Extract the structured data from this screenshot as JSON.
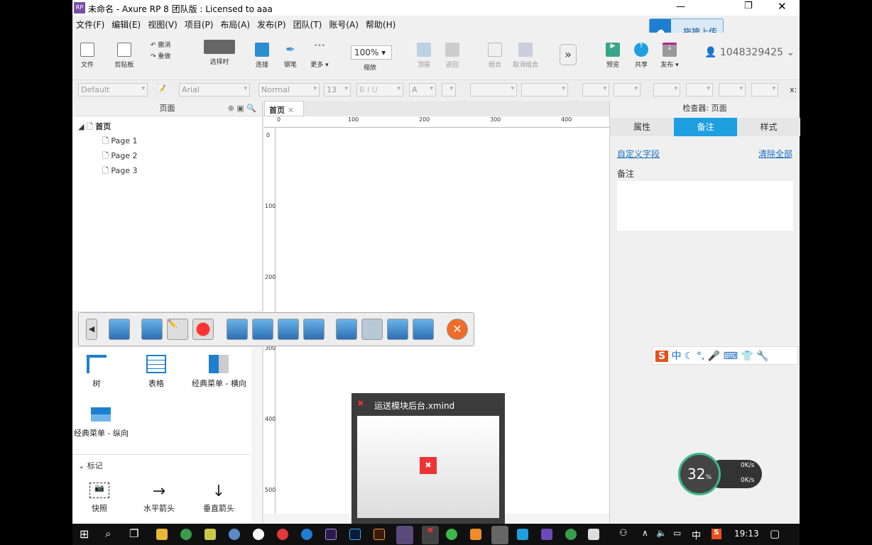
{
  "window": {
    "title": "未命名 - Axure RP 8 团队版 : Licensed to aaa",
    "app_icon": "RP"
  },
  "menu": [
    "文件(F)",
    "编辑(E)",
    "视图(V)",
    "项目(P)",
    "布局(A)",
    "发布(P)",
    "团队(T)",
    "账号(A)",
    "帮助(H)"
  ],
  "upload_badge": "拖拽上传",
  "toolbar": {
    "file": "文件",
    "clipboard": "剪贴板",
    "undo": "撤消",
    "redo": "重做",
    "select": "选择时",
    "connect": "连接",
    "pen": "钢笔",
    "more": "更多 ▾",
    "zoom_value": "100%",
    "zoom": "缩放",
    "top": "顶层",
    "back": "返回",
    "group": "组合",
    "ungroup": "取消组合",
    "preview": "预览",
    "share": "共享",
    "publish": "发布 ▾",
    "user": "1048329425"
  },
  "format": {
    "style": "Default",
    "font": "Arial",
    "weight": "Normal",
    "size": "13",
    "x_label": "x:"
  },
  "pages": {
    "title": "页面",
    "root": "首页",
    "items": [
      "Page 1",
      "Page 2",
      "Page 3"
    ]
  },
  "canvas": {
    "tab": "首页",
    "ruler_h": [
      "0",
      "100",
      "200",
      "300",
      "400"
    ],
    "ruler_v": [
      "0",
      "100",
      "200",
      "300",
      "400",
      "500"
    ]
  },
  "inspector": {
    "title": "检查器: 页面",
    "tabs": [
      "属性",
      "备注",
      "样式"
    ],
    "active_tab": "备注",
    "custom_fields": "自定义字段",
    "clear_all": "清除全部",
    "notes_label": "备注"
  },
  "widgets": {
    "items": [
      "树",
      "表格",
      "经典菜单 - 横向",
      "经典菜单 - 纵向"
    ],
    "section": "标记",
    "markers": [
      "快照",
      "水平箭头",
      "垂直箭头"
    ]
  },
  "xmind": {
    "title": "运送模块后台.xmind"
  },
  "netmon": {
    "cpu": "32",
    "unit": "%",
    "up": "0K/s",
    "down": "0K/s"
  },
  "ime": {
    "lang": "中"
  },
  "tray": {
    "lang": "中",
    "time": "19:13"
  },
  "colors": {
    "accent": "#1e9fe0",
    "tab_active": "#1e9fe0"
  }
}
